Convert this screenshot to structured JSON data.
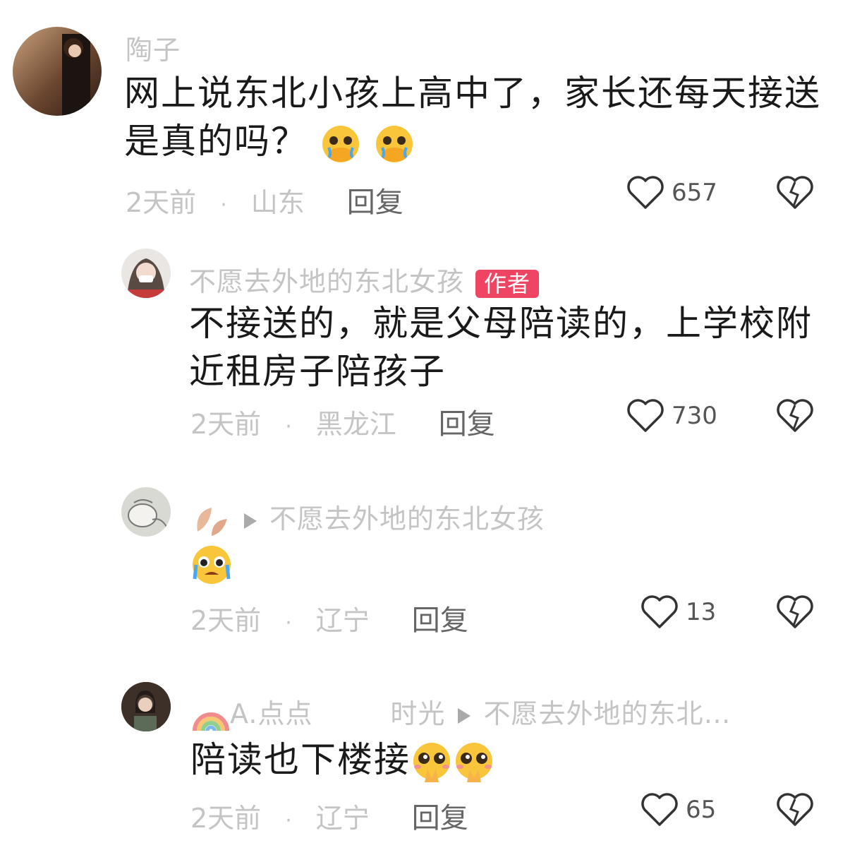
{
  "comments": [
    {
      "name": "陶子",
      "text_line1": "网上说东北小孩上高中了，家长还每天接送",
      "text_line2": "是真的吗？",
      "time": "2天前",
      "location": "山东",
      "reply": "回复",
      "likes": "657"
    },
    {
      "name": "不愿去外地的东北女孩",
      "badge": "作者",
      "text_line1": "不接送的，就是父母陪读的，上学校附",
      "text_line2": "近租房子陪孩子",
      "time": "2天前",
      "location": "黑龙江",
      "reply": "回复",
      "likes": "730"
    },
    {
      "reply_to": "不愿去外地的东北女孩",
      "time": "2天前",
      "location": "辽宁",
      "reply": "回复",
      "likes": "13"
    },
    {
      "name_part1": "A.点点",
      "name_part2": "时光",
      "reply_to": "不愿去外地的东北…",
      "text": "陪读也下楼接",
      "time": "2天前",
      "location": "辽宁",
      "reply": "回复",
      "likes": "65"
    }
  ],
  "colors": {
    "badge": "#ee4662",
    "muted": "#c4c4c4",
    "text": "#1a1a1a"
  },
  "icons": [
    "heart-outline-icon",
    "broken-heart-icon",
    "crying-face-emoji",
    "sob-emoji",
    "pleading-hands-emoji",
    "rainbow-emoji",
    "leaf-emoji"
  ]
}
